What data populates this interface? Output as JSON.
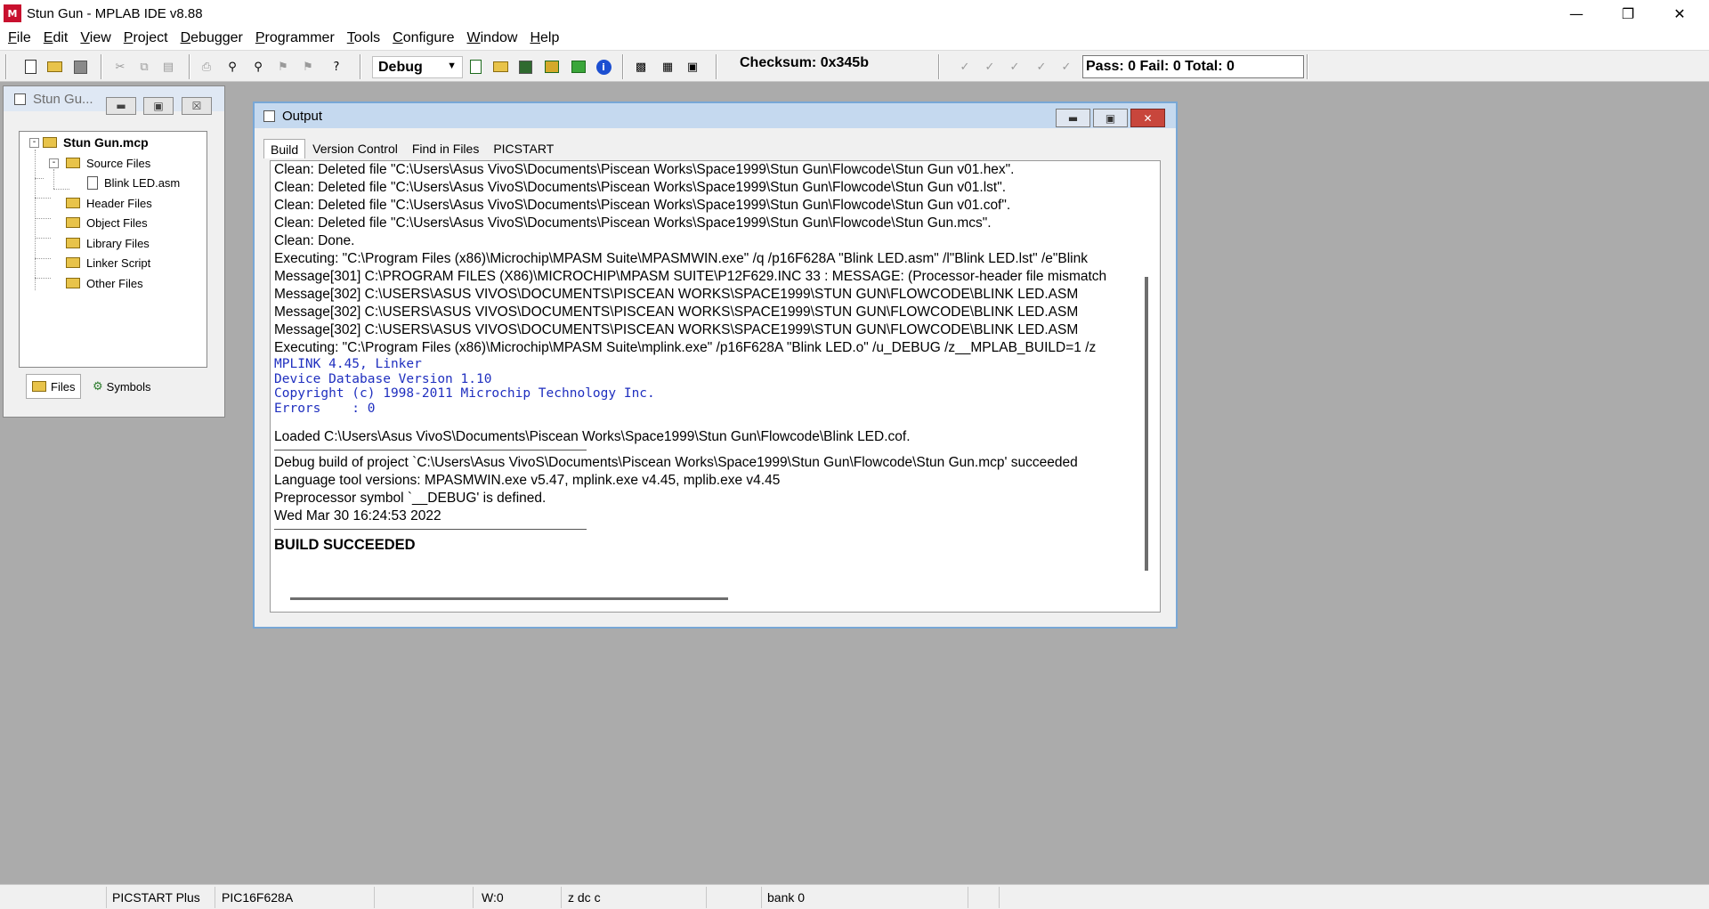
{
  "window": {
    "title": "Stun Gun - MPLAB IDE v8.88",
    "app_icon_text": "M"
  },
  "menu": [
    "File",
    "Edit",
    "View",
    "Project",
    "Debugger",
    "Programmer",
    "Tools",
    "Configure",
    "Window",
    "Help"
  ],
  "toolbar": {
    "build_config": "Debug",
    "checksum": "Checksum:  0x345b",
    "pass_fail": "Pass: 0  Fail: 0  Total: 0",
    "icons": [
      "new-file-icon",
      "open-folder-icon",
      "save-icon",
      "cut-icon",
      "copy-icon",
      "paste-icon",
      "print-icon",
      "find-icon",
      "find-in-files-icon",
      "bookmark-icon",
      "bookmark-next-icon",
      "help-icon",
      "add-file-icon",
      "open-project-icon",
      "save-project-icon",
      "build-icon",
      "rebuild-icon",
      "info-icon",
      "programmer-icon",
      "settings-icon",
      "view-icon"
    ]
  },
  "project_window": {
    "title": "Stun Gu...",
    "tree": {
      "root": "Stun Gun.mcp",
      "source_files": "Source Files",
      "source_file_1": "Blink LED.asm",
      "header_files": "Header Files",
      "object_files": "Object Files",
      "library_files": "Library Files",
      "linker_script": "Linker Script",
      "other_files": "Other Files"
    },
    "tabs": {
      "files": "Files",
      "symbols": "Symbols"
    }
  },
  "output_window": {
    "title": "Output",
    "tabs": [
      "Build",
      "Version Control",
      "Find in Files",
      "PICSTART"
    ],
    "active_tab": "Build",
    "lines": {
      "l1": "Clean: Deleted file \"C:\\Users\\Asus VivoS\\Documents\\Piscean Works\\Space1999\\Stun Gun\\Flowcode\\Stun Gun v01.hex\".",
      "l2": "Clean: Deleted file \"C:\\Users\\Asus VivoS\\Documents\\Piscean Works\\Space1999\\Stun Gun\\Flowcode\\Stun Gun v01.lst\".",
      "l3": "Clean: Deleted file \"C:\\Users\\Asus VivoS\\Documents\\Piscean Works\\Space1999\\Stun Gun\\Flowcode\\Stun Gun v01.cof\".",
      "l4": "Clean: Deleted file \"C:\\Users\\Asus VivoS\\Documents\\Piscean Works\\Space1999\\Stun Gun\\Flowcode\\Stun Gun.mcs\".",
      "l5": "Clean: Done.",
      "l6": "Executing: \"C:\\Program Files (x86)\\Microchip\\MPASM Suite\\MPASMWIN.exe\" /q /p16F628A \"Blink LED.asm\" /l\"Blink LED.lst\" /e\"Blink",
      "l7": "Message[301] C:\\PROGRAM FILES (X86)\\MICROCHIP\\MPASM SUITE\\P12F629.INC 33 : MESSAGE: (Processor-header file mismatch",
      "l8": "Message[302] C:\\USERS\\ASUS VIVOS\\DOCUMENTS\\PISCEAN WORKS\\SPACE1999\\STUN GUN\\FLOWCODE\\BLINK LED.ASM",
      "l9": "Message[302] C:\\USERS\\ASUS VIVOS\\DOCUMENTS\\PISCEAN WORKS\\SPACE1999\\STUN GUN\\FLOWCODE\\BLINK LED.ASM",
      "l10": "Message[302] C:\\USERS\\ASUS VIVOS\\DOCUMENTS\\PISCEAN WORKS\\SPACE1999\\STUN GUN\\FLOWCODE\\BLINK LED.ASM",
      "l11": "Executing: \"C:\\Program Files (x86)\\Microchip\\MPASM Suite\\mplink.exe\" /p16F628A \"Blink LED.o\" /u_DEBUG /z__MPLAB_BUILD=1 /z",
      "l12": "MPLINK 4.45, Linker",
      "l13": "Device Database Version 1.10",
      "l14": "Copyright (c) 1998-2011 Microchip Technology Inc.",
      "l15": "Errors    : 0",
      "l16": "Loaded C:\\Users\\Asus VivoS\\Documents\\Piscean Works\\Space1999\\Stun Gun\\Flowcode\\Blink LED.cof.",
      "l17": "Debug build of project `C:\\Users\\Asus VivoS\\Documents\\Piscean Works\\Space1999\\Stun Gun\\Flowcode\\Stun Gun.mcp' succeeded",
      "l18": "Language tool versions: MPASMWIN.exe v5.47, mplink.exe v4.45, mplib.exe v4.45",
      "l19": "Preprocessor symbol `__DEBUG' is defined.",
      "l20": "Wed Mar 30 16:24:53 2022",
      "l21": "BUILD SUCCEEDED"
    }
  },
  "statusbar": {
    "programmer": "PICSTART Plus",
    "device": "PIC16F628A",
    "w_reg": "W:0",
    "flags": "z dc c",
    "bank": "bank 0"
  },
  "colors": {
    "linker_text": "#1f2fbf",
    "background": "#ababab",
    "close_button": "#c8463c"
  }
}
